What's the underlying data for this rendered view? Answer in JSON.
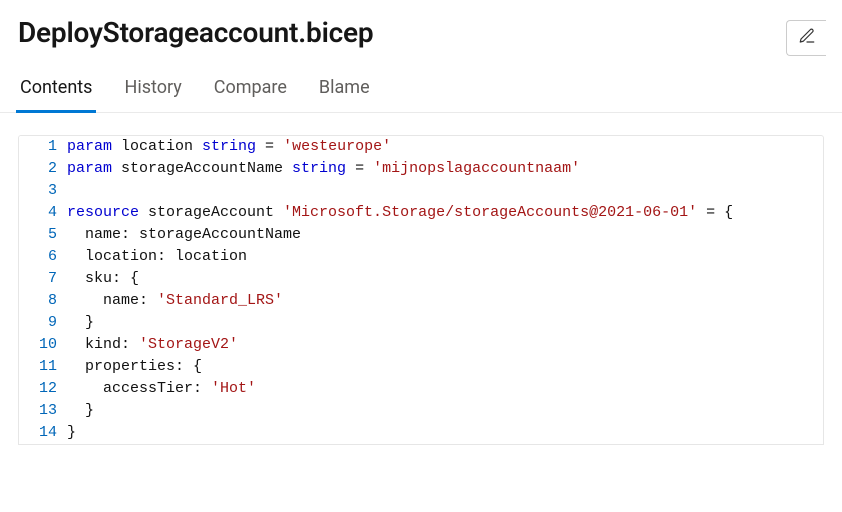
{
  "header": {
    "title": "DeployStorageaccount.bicep",
    "edit_icon": "pencil-icon"
  },
  "tabs": {
    "contents": "Contents",
    "history": "History",
    "compare": "Compare",
    "blame": "Blame",
    "activeIndex": 0
  },
  "code": {
    "lines": [
      {
        "num": "1",
        "tokens": [
          {
            "cls": "tk-kw",
            "t": "param"
          },
          {
            "cls": "tk-id",
            "t": " location "
          },
          {
            "cls": "tk-kw",
            "t": "string"
          },
          {
            "cls": "tk-punc",
            "t": " = "
          },
          {
            "cls": "tk-str",
            "t": "'westeurope'"
          }
        ]
      },
      {
        "num": "2",
        "tokens": [
          {
            "cls": "tk-kw",
            "t": "param"
          },
          {
            "cls": "tk-id",
            "t": " storageAccountName "
          },
          {
            "cls": "tk-kw",
            "t": "string"
          },
          {
            "cls": "tk-punc",
            "t": " = "
          },
          {
            "cls": "tk-str",
            "t": "'mijnopslagaccountnaam'"
          }
        ]
      },
      {
        "num": "3",
        "tokens": []
      },
      {
        "num": "4",
        "tokens": [
          {
            "cls": "tk-kw",
            "t": "resource"
          },
          {
            "cls": "tk-id",
            "t": " storageAccount "
          },
          {
            "cls": "tk-str",
            "t": "'Microsoft.Storage/storageAccounts@2021-06-01'"
          },
          {
            "cls": "tk-punc",
            "t": " = {"
          }
        ]
      },
      {
        "num": "5",
        "tokens": [
          {
            "cls": "tk-id",
            "t": "  name: storageAccountName"
          }
        ]
      },
      {
        "num": "6",
        "tokens": [
          {
            "cls": "tk-id",
            "t": "  location: location"
          }
        ]
      },
      {
        "num": "7",
        "tokens": [
          {
            "cls": "tk-id",
            "t": "  sku: {"
          }
        ]
      },
      {
        "num": "8",
        "tokens": [
          {
            "cls": "tk-id",
            "t": "    name: "
          },
          {
            "cls": "tk-str",
            "t": "'Standard_LRS'"
          }
        ]
      },
      {
        "num": "9",
        "tokens": [
          {
            "cls": "tk-id",
            "t": "  }"
          }
        ]
      },
      {
        "num": "10",
        "tokens": [
          {
            "cls": "tk-id",
            "t": "  kind: "
          },
          {
            "cls": "tk-str",
            "t": "'StorageV2'"
          }
        ]
      },
      {
        "num": "11",
        "tokens": [
          {
            "cls": "tk-id",
            "t": "  properties: {"
          }
        ]
      },
      {
        "num": "12",
        "tokens": [
          {
            "cls": "tk-id",
            "t": "    accessTier: "
          },
          {
            "cls": "tk-str",
            "t": "'Hot'"
          }
        ]
      },
      {
        "num": "13",
        "tokens": [
          {
            "cls": "tk-id",
            "t": "  }"
          }
        ]
      },
      {
        "num": "14",
        "tokens": [
          {
            "cls": "tk-id",
            "t": "}"
          }
        ]
      }
    ]
  }
}
